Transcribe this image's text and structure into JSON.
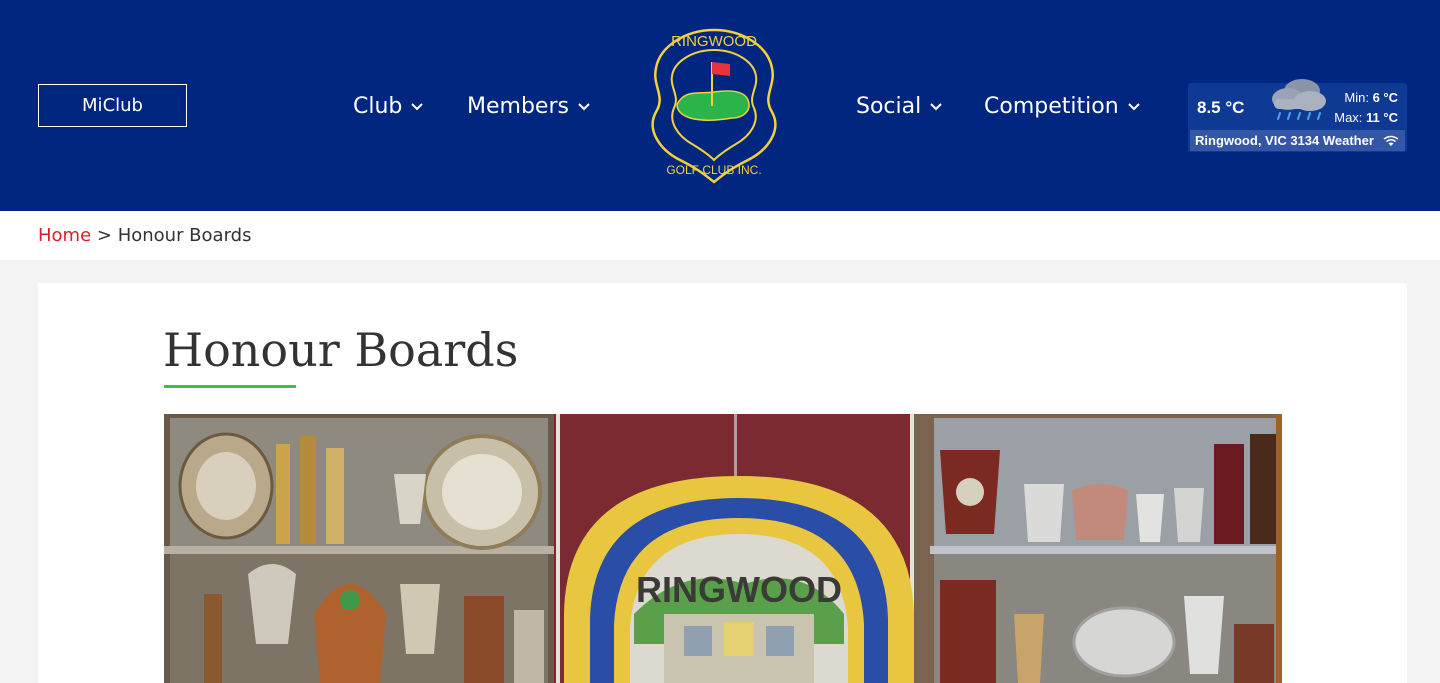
{
  "header": {
    "miclub_label": "MiClub",
    "nav": [
      {
        "label": "Club"
      },
      {
        "label": "Members"
      },
      {
        "label": "Social"
      },
      {
        "label": "Competition"
      }
    ],
    "logo": {
      "text_top": "RINGWOOD",
      "text_bottom": "GOLF CLUB INC."
    }
  },
  "weather": {
    "temperature": "8.5 °C",
    "min_label": "Min:",
    "min_value": "6 °C",
    "max_label": "Max:",
    "max_value": "11 °C",
    "location": "Ringwood, VIC 3134 Weather",
    "icon": "rain-cloud-icon"
  },
  "breadcrumb": {
    "home": "Home",
    "separator": " > ",
    "current": "Honour Boards"
  },
  "main": {
    "title": "Honour Boards",
    "accent_color": "#35c44a"
  },
  "colors": {
    "header_bg": "#002680",
    "link": "#d61f2b"
  }
}
